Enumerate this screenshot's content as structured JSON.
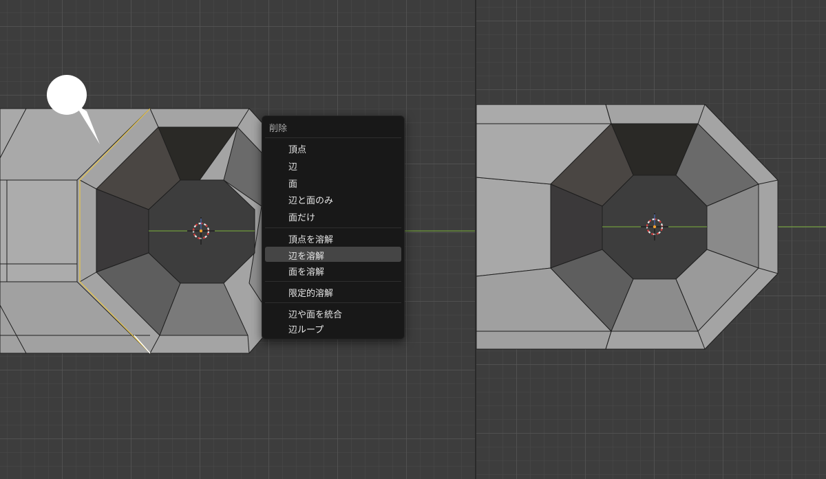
{
  "colors": {
    "viewport_bg": "#3d3d3d",
    "grid_major": "#5a5a5a",
    "grid_minor": "#4b4b4b",
    "mesh_face": "#a3a3a3",
    "selected_edge": "#e8c547",
    "axis_x": "#7db33c",
    "menu_bg": "#181818",
    "menu_highlight": "#454545"
  },
  "icons": {
    "cursor": "3d-cursor-icon",
    "pin": "callout-pin-icon",
    "origin": "object-origin-icon"
  },
  "context_menu": {
    "title": "削除",
    "items": [
      {
        "label": "頂点",
        "highlighted": false
      },
      {
        "label": "辺",
        "highlighted": false
      },
      {
        "label": "面",
        "highlighted": false
      },
      {
        "label": "辺と面のみ",
        "highlighted": false
      },
      {
        "label": "面だけ",
        "highlighted": false
      },
      {
        "label": "頂点を溶解",
        "highlighted": false
      },
      {
        "label": "辺を溶解",
        "highlighted": true
      },
      {
        "label": "面を溶解",
        "highlighted": false
      },
      {
        "label": "限定的溶解",
        "highlighted": false
      },
      {
        "label": "辺や面を統合",
        "highlighted": false
      },
      {
        "label": "辺ループ",
        "highlighted": false
      }
    ]
  }
}
